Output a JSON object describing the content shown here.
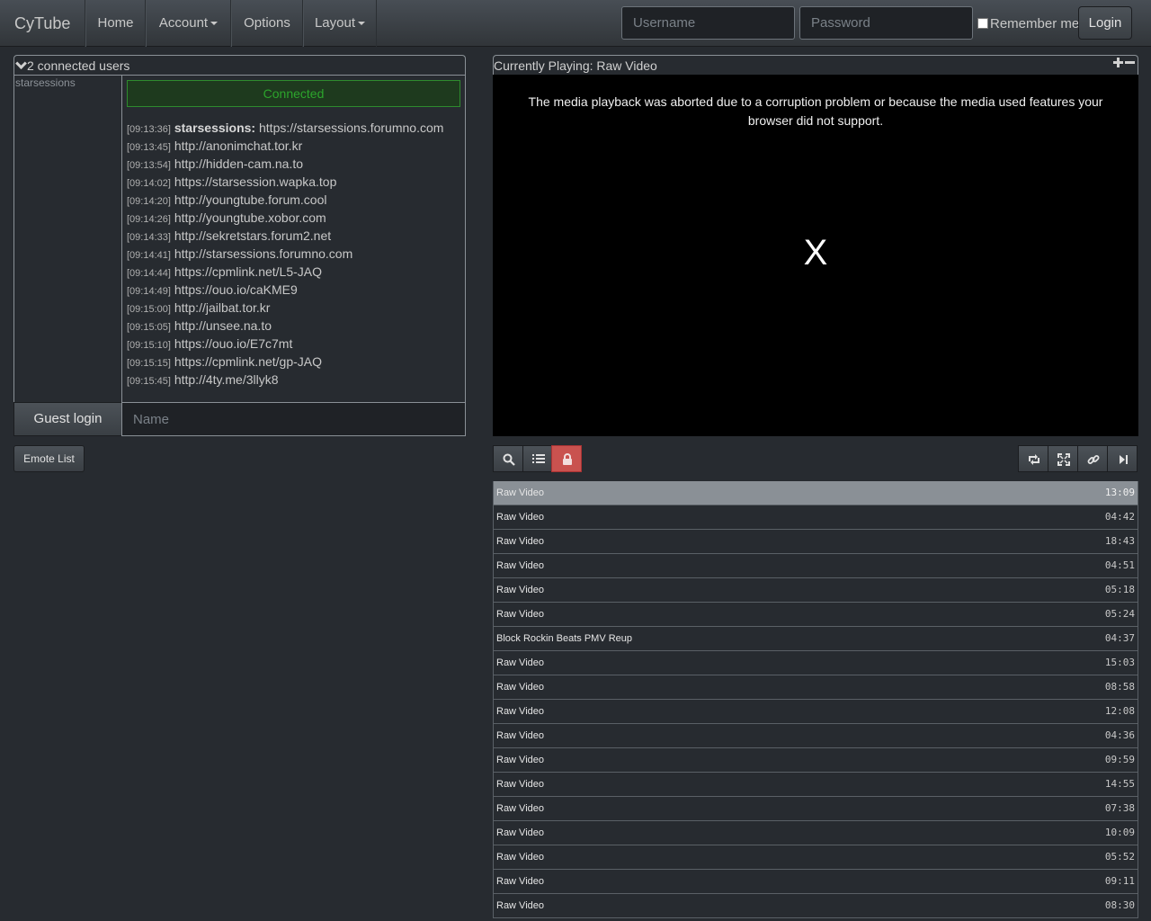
{
  "navbar": {
    "brand": "CyTube",
    "items": [
      "Home",
      "Account",
      "Options",
      "Layout"
    ],
    "username_placeholder": "Username",
    "password_placeholder": "Password",
    "remember_label": "Remember me",
    "login_label": "Login"
  },
  "userlist": {
    "header": "2 connected users",
    "users": [
      "starsessions"
    ]
  },
  "chat": {
    "connected": "Connected",
    "messages": [
      {
        "time": "[09:13:36]",
        "user": "starsessions:",
        "text": "https://starsessions.forumno.com"
      },
      {
        "time": "[09:13:45]",
        "user": "",
        "text": "http://anonimchat.tor.kr"
      },
      {
        "time": "[09:13:54]",
        "user": "",
        "text": "http://hidden-cam.na.to"
      },
      {
        "time": "[09:14:02]",
        "user": "",
        "text": "https://starsession.wapka.top"
      },
      {
        "time": "[09:14:20]",
        "user": "",
        "text": "http://youngtube.forum.cool"
      },
      {
        "time": "[09:14:26]",
        "user": "",
        "text": "http://youngtube.xobor.com"
      },
      {
        "time": "[09:14:33]",
        "user": "",
        "text": "http://sekretstars.forum2.net"
      },
      {
        "time": "[09:14:41]",
        "user": "",
        "text": "http://starsessions.forumno.com"
      },
      {
        "time": "[09:14:44]",
        "user": "",
        "text": "https://cpmlink.net/L5-JAQ"
      },
      {
        "time": "[09:14:49]",
        "user": "",
        "text": "https://ouo.io/caKME9"
      },
      {
        "time": "[09:15:00]",
        "user": "",
        "text": "http://jailbat.tor.kr"
      },
      {
        "time": "[09:15:05]",
        "user": "",
        "text": "http://unsee.na.to"
      },
      {
        "time": "[09:15:10]",
        "user": "",
        "text": "https://ouo.io/E7c7mt"
      },
      {
        "time": "[09:15:15]",
        "user": "",
        "text": "https://cpmlink.net/gp-JAQ"
      },
      {
        "time": "[09:15:45]",
        "user": "",
        "text": "http://4ty.me/3llyk8"
      }
    ],
    "guest_login": "Guest login",
    "name_placeholder": "Name",
    "emote_list": "Emote List"
  },
  "video": {
    "header": "Currently Playing: Raw Video",
    "error": "The media playback was aborted due to a corruption problem or because the media used features your browser did not support.",
    "close_glyph": "X"
  },
  "controls": {
    "left": [
      "search-icon",
      "list-icon",
      "lock-icon"
    ],
    "right": [
      "retweet-icon",
      "fullscreen-icon",
      "link-icon",
      "skip-icon"
    ]
  },
  "playlist": [
    {
      "title": "Raw Video",
      "time": "13:09",
      "active": true
    },
    {
      "title": "Raw Video",
      "time": "04:42"
    },
    {
      "title": "Raw Video",
      "time": "18:43"
    },
    {
      "title": "Raw Video",
      "time": "04:51"
    },
    {
      "title": "Raw Video",
      "time": "05:18"
    },
    {
      "title": "Raw Video",
      "time": "05:24"
    },
    {
      "title": "Block Rockin Beats PMV Reup",
      "time": "04:37"
    },
    {
      "title": "Raw Video",
      "time": "15:03"
    },
    {
      "title": "Raw Video",
      "time": "08:58"
    },
    {
      "title": "Raw Video",
      "time": "12:08"
    },
    {
      "title": "Raw Video",
      "time": "04:36"
    },
    {
      "title": "Raw Video",
      "time": "09:59"
    },
    {
      "title": "Raw Video",
      "time": "14:55"
    },
    {
      "title": "Raw Video",
      "time": "07:38"
    },
    {
      "title": "Raw Video",
      "time": "10:09"
    },
    {
      "title": "Raw Video",
      "time": "05:52"
    },
    {
      "title": "Raw Video",
      "time": "09:11"
    },
    {
      "title": "Raw Video",
      "time": "08:30"
    }
  ]
}
